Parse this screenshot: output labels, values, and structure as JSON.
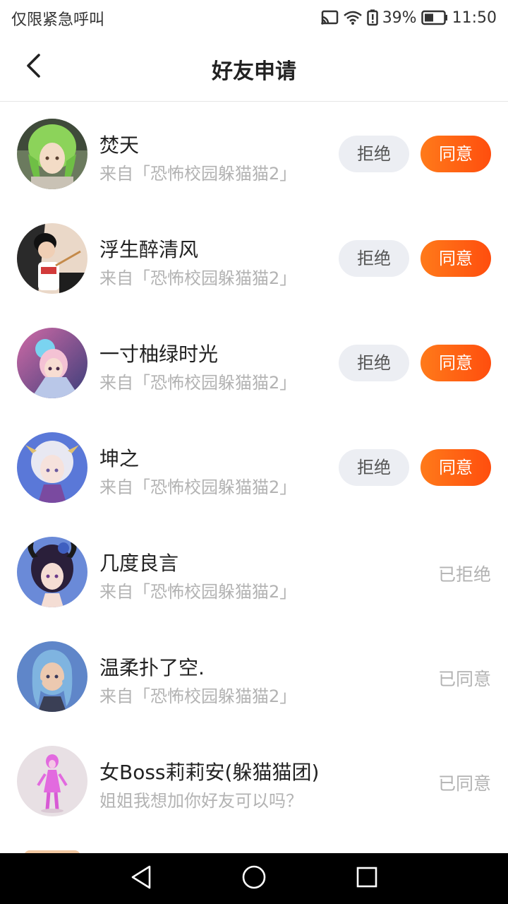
{
  "status_bar": {
    "emergency_text": "仅限紧急呼叫",
    "battery_percent": "39%",
    "time": "11:50",
    "icons": [
      "cast-icon",
      "wifi-icon",
      "battery-alert-icon",
      "battery-icon"
    ]
  },
  "header": {
    "title": "好友申请",
    "back_icon": "back-arrow-icon"
  },
  "buttons": {
    "reject_label": "拒绝",
    "accept_label": "同意"
  },
  "requests": [
    {
      "name": "焚天",
      "source": "来自「恐怖校园躲猫猫2」",
      "state": "pending"
    },
    {
      "name": "浮生醉清风",
      "source": "来自「恐怖校园躲猫猫2」",
      "state": "pending"
    },
    {
      "name": "一寸柚绿时光",
      "source": "来自「恐怖校园躲猫猫2」",
      "state": "pending"
    },
    {
      "name": "坤之",
      "source": "来自「恐怖校园躲猫猫2」",
      "state": "pending"
    },
    {
      "name": "几度良言",
      "source": "来自「恐怖校园躲猫猫2」",
      "state": "rejected",
      "status_text": "已拒绝"
    },
    {
      "name": "温柔扑了空.",
      "source": "来自「恐怖校园躲猫猫2」",
      "state": "accepted",
      "status_text": "已同意"
    },
    {
      "name": "女Boss莉莉安(躲猫猫团)",
      "source": "姐姐我想加你好友可以吗？",
      "state": "accepted",
      "status_text": "已同意"
    }
  ],
  "colors": {
    "accent_start": "#ff7a1a",
    "accent_end": "#ff4e0e",
    "reject_bg": "#eceef3",
    "muted_text": "#b3b3b3"
  },
  "nav_bar": {
    "icons": [
      "nav-back-icon",
      "nav-home-icon",
      "nav-recents-icon"
    ]
  }
}
